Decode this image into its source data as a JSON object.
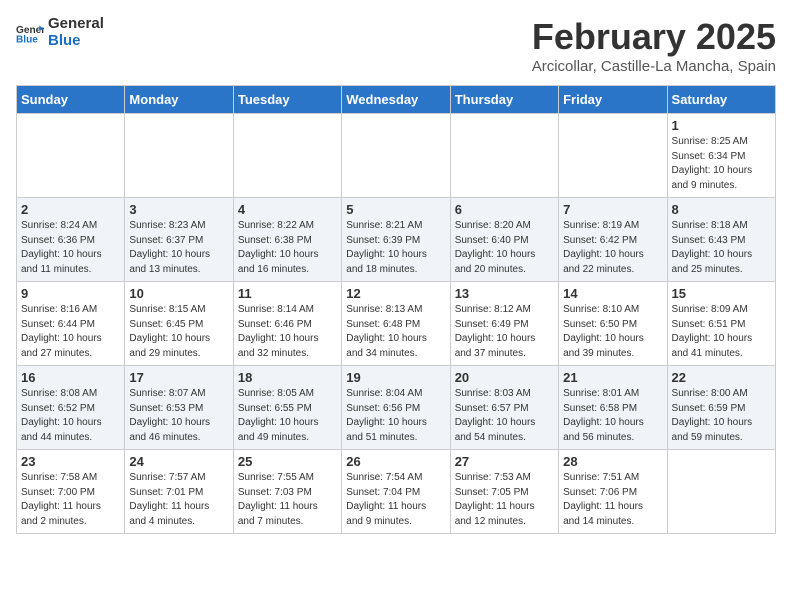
{
  "header": {
    "logo_general": "General",
    "logo_blue": "Blue",
    "month_year": "February 2025",
    "location": "Arcicollar, Castille-La Mancha, Spain"
  },
  "days_of_week": [
    "Sunday",
    "Monday",
    "Tuesday",
    "Wednesday",
    "Thursday",
    "Friday",
    "Saturday"
  ],
  "weeks": [
    [
      {
        "day": "",
        "info": ""
      },
      {
        "day": "",
        "info": ""
      },
      {
        "day": "",
        "info": ""
      },
      {
        "day": "",
        "info": ""
      },
      {
        "day": "",
        "info": ""
      },
      {
        "day": "",
        "info": ""
      },
      {
        "day": "1",
        "info": "Sunrise: 8:25 AM\nSunset: 6:34 PM\nDaylight: 10 hours\nand 9 minutes."
      }
    ],
    [
      {
        "day": "2",
        "info": "Sunrise: 8:24 AM\nSunset: 6:36 PM\nDaylight: 10 hours\nand 11 minutes."
      },
      {
        "day": "3",
        "info": "Sunrise: 8:23 AM\nSunset: 6:37 PM\nDaylight: 10 hours\nand 13 minutes."
      },
      {
        "day": "4",
        "info": "Sunrise: 8:22 AM\nSunset: 6:38 PM\nDaylight: 10 hours\nand 16 minutes."
      },
      {
        "day": "5",
        "info": "Sunrise: 8:21 AM\nSunset: 6:39 PM\nDaylight: 10 hours\nand 18 minutes."
      },
      {
        "day": "6",
        "info": "Sunrise: 8:20 AM\nSunset: 6:40 PM\nDaylight: 10 hours\nand 20 minutes."
      },
      {
        "day": "7",
        "info": "Sunrise: 8:19 AM\nSunset: 6:42 PM\nDaylight: 10 hours\nand 22 minutes."
      },
      {
        "day": "8",
        "info": "Sunrise: 8:18 AM\nSunset: 6:43 PM\nDaylight: 10 hours\nand 25 minutes."
      }
    ],
    [
      {
        "day": "9",
        "info": "Sunrise: 8:16 AM\nSunset: 6:44 PM\nDaylight: 10 hours\nand 27 minutes."
      },
      {
        "day": "10",
        "info": "Sunrise: 8:15 AM\nSunset: 6:45 PM\nDaylight: 10 hours\nand 29 minutes."
      },
      {
        "day": "11",
        "info": "Sunrise: 8:14 AM\nSunset: 6:46 PM\nDaylight: 10 hours\nand 32 minutes."
      },
      {
        "day": "12",
        "info": "Sunrise: 8:13 AM\nSunset: 6:48 PM\nDaylight: 10 hours\nand 34 minutes."
      },
      {
        "day": "13",
        "info": "Sunrise: 8:12 AM\nSunset: 6:49 PM\nDaylight: 10 hours\nand 37 minutes."
      },
      {
        "day": "14",
        "info": "Sunrise: 8:10 AM\nSunset: 6:50 PM\nDaylight: 10 hours\nand 39 minutes."
      },
      {
        "day": "15",
        "info": "Sunrise: 8:09 AM\nSunset: 6:51 PM\nDaylight: 10 hours\nand 41 minutes."
      }
    ],
    [
      {
        "day": "16",
        "info": "Sunrise: 8:08 AM\nSunset: 6:52 PM\nDaylight: 10 hours\nand 44 minutes."
      },
      {
        "day": "17",
        "info": "Sunrise: 8:07 AM\nSunset: 6:53 PM\nDaylight: 10 hours\nand 46 minutes."
      },
      {
        "day": "18",
        "info": "Sunrise: 8:05 AM\nSunset: 6:55 PM\nDaylight: 10 hours\nand 49 minutes."
      },
      {
        "day": "19",
        "info": "Sunrise: 8:04 AM\nSunset: 6:56 PM\nDaylight: 10 hours\nand 51 minutes."
      },
      {
        "day": "20",
        "info": "Sunrise: 8:03 AM\nSunset: 6:57 PM\nDaylight: 10 hours\nand 54 minutes."
      },
      {
        "day": "21",
        "info": "Sunrise: 8:01 AM\nSunset: 6:58 PM\nDaylight: 10 hours\nand 56 minutes."
      },
      {
        "day": "22",
        "info": "Sunrise: 8:00 AM\nSunset: 6:59 PM\nDaylight: 10 hours\nand 59 minutes."
      }
    ],
    [
      {
        "day": "23",
        "info": "Sunrise: 7:58 AM\nSunset: 7:00 PM\nDaylight: 11 hours\nand 2 minutes."
      },
      {
        "day": "24",
        "info": "Sunrise: 7:57 AM\nSunset: 7:01 PM\nDaylight: 11 hours\nand 4 minutes."
      },
      {
        "day": "25",
        "info": "Sunrise: 7:55 AM\nSunset: 7:03 PM\nDaylight: 11 hours\nand 7 minutes."
      },
      {
        "day": "26",
        "info": "Sunrise: 7:54 AM\nSunset: 7:04 PM\nDaylight: 11 hours\nand 9 minutes."
      },
      {
        "day": "27",
        "info": "Sunrise: 7:53 AM\nSunset: 7:05 PM\nDaylight: 11 hours\nand 12 minutes."
      },
      {
        "day": "28",
        "info": "Sunrise: 7:51 AM\nSunset: 7:06 PM\nDaylight: 11 hours\nand 14 minutes."
      },
      {
        "day": "",
        "info": ""
      }
    ]
  ]
}
